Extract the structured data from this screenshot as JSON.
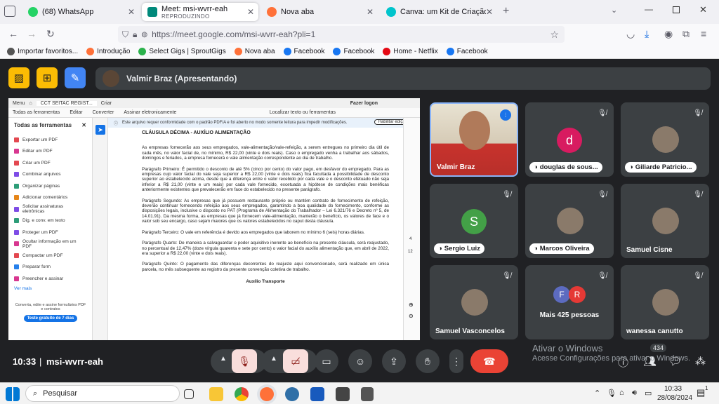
{
  "tabs": [
    {
      "title": "(68) WhatsApp",
      "color": "#25d366"
    },
    {
      "title": "Meet: msi-wvrr-eah",
      "subtitle": "REPRODUZINDO",
      "color": "#00897b"
    },
    {
      "title": "Nova aba",
      "color": "#ff7139"
    },
    {
      "title": "Canva: um Kit de Criação Visual",
      "color": "#00c4cc"
    }
  ],
  "url": "https://meet.google.com/msi-wvrr-eah?pli=1",
  "bookmarks": [
    {
      "label": "Importar favoritos...",
      "icon": "import-icon",
      "color": "#555"
    },
    {
      "label": "Introdução",
      "icon": "firefox-icon",
      "color": "#ff7139"
    },
    {
      "label": "Select Gigs | SproutGigs",
      "icon": "sproutgigs-icon",
      "color": "#2bb24c"
    },
    {
      "label": "Nova aba",
      "icon": "firefox-icon",
      "color": "#ff7139"
    },
    {
      "label": "Facebook",
      "icon": "facebook-icon",
      "color": "#1877f2"
    },
    {
      "label": "Facebook",
      "icon": "facebook-icon",
      "color": "#1877f2"
    },
    {
      "label": "Home - Netflix",
      "icon": "netflix-icon",
      "color": "#e50914"
    },
    {
      "label": "Facebook",
      "icon": "facebook-icon",
      "color": "#1877f2"
    }
  ],
  "presenter": "Valmir Braz (Apresentando)",
  "pdf": {
    "menu": "Menu",
    "tab": "CCT SEITAC REGIST...",
    "new_tab": "Criar",
    "login": "Fazer logon",
    "toolbar": [
      "Todas as ferramentas",
      "Editar",
      "Converter",
      "Assinar eletronicamente"
    ],
    "search": "Localizar texto ou ferramentas",
    "panel_title": "Todas as ferramentas",
    "tools": [
      {
        "label": "Exportar um PDF",
        "color": "#e34850"
      },
      {
        "label": "Editar um PDF",
        "color": "#d83790"
      },
      {
        "label": "Criar um PDF",
        "color": "#e34850"
      },
      {
        "label": "Combinar arquivos",
        "color": "#7e4ce6"
      },
      {
        "label": "Organizar páginas",
        "color": "#2d9d78"
      },
      {
        "label": "Adicionar comentários",
        "color": "#e68619"
      },
      {
        "label": "Solicitar assinaturas eletrônicas",
        "color": "#7e4ce6"
      },
      {
        "label": "Dig. e conv. em texto",
        "color": "#2d9d78"
      },
      {
        "label": "Proteger um PDF",
        "color": "#7e4ce6"
      },
      {
        "label": "Ocultar informação em um PDF",
        "color": "#d83790"
      },
      {
        "label": "Compactar um PDF",
        "color": "#e34850"
      },
      {
        "label": "Preparar form",
        "color": "#2680eb"
      },
      {
        "label": "Preencher e assinar",
        "color": "#d83790"
      }
    ],
    "more": "Ver mais",
    "promo": "Converta, edite e assine formulários PDF e contratos",
    "trial": "Teste gratuito de 7 dias",
    "notice": "Este arquivo requer conformidade com o padrão PDF/A e foi aberto no modo somente leitura para impedir modificações.",
    "enable": "Habilitar edição",
    "page_num": "12",
    "page_prev": "4"
  },
  "doc": {
    "heading": "CLÁUSULA DÉCIMA - AUXÍLIO ALIMENTAÇÃO",
    "p0": "As empresas fornecerão aos seus empregados, vale-alimentação/vale-refeição, a serem entregues no primeiro dia útil de cada mês, no valor facial de, no mínimo, R$ 22,00 (vinte e dois reais). Caso o empregado venha a trabalhar aos sábados, domingos e feriados, a empresa fornecerá o vale alimentação correspondente ao dia de trabalho.",
    "p1": "Parágrafo Primeiro: É permitido o desconto de até 5% (cinco por cento) do valor pago, em desfavor do empregado. Para as empresas cujo valor facial do vale seja superior a R$ 22,00 (vinte e dois reais) fica facultada a possibilidade de desconto superior ao estabelecido acima, desde que a diferença entre o valor recebido por cada vale e o desconto efetuado não seja inferior a R$ 21,00 (vinte e um reais) por cada vale fornecido, excetuada a hipótese de condições mais benéficas anteriormente existentes que prevalecerão em face do estabelecido no presente parágrafo.",
    "p2": "Parágrafo Segundo: As empresas que já possuem restaurante próprio ou mantém contrato de fornecimento de refeição, deverão continuar fornecendo refeição aos seus empregados, garantindo a boa qualidade do fornecimento, conforme as disposições legais, inclusive o disposto no PAT (Programa de Alimentação do Trabalhador – Lei 6.321/76 e Decreto nº 5, de 14.01.91). Da mesma forma, as empresas que já fornecem vale-alimentação, manterão o benefício, os valores de face e o valor sob seu encargo, caso sejam maiores que os valores estabelecidos no caput desta cláusula.",
    "p3": "Parágrafo Terceiro: O vale em referência é devido aos empregados que laborem no mínimo 6 (seis) horas diárias.",
    "p4": "Parágrafo Quarto: De maneira a salvaguardar o poder aquisitivo inerente ao benefício na presente cláusula, será reajustado, no percentual de 12,47% (doze vírgula quarenta e sete por cento) o valor facial do auxílio alimentação que, em abril de 2022, era superior a R$ 22,00 (vinte e dois reais).",
    "p5": "Parágrafo Quinto: O pagamento das diferenças decorrentes do reajuste aqui convencionado, será realizado em única parcela, no mês subsequente ao registro da presente convenção coletiva de trabalho.",
    "next": "Auxílio Transporte"
  },
  "participants": [
    {
      "name": "Valmir Braz",
      "style": "video"
    },
    {
      "name": "douglas de sous...",
      "letter": "d",
      "color": "#d81b60",
      "style": "pill"
    },
    {
      "name": "Giliarde Patricio...",
      "style": "pill-photo"
    },
    {
      "name": "Sergio Luiz",
      "letter": "S",
      "color": "#43a047",
      "style": "pill"
    },
    {
      "name": "Marcos Oliveira",
      "style": "pill-photo"
    },
    {
      "name": "Samuel Cisne",
      "style": "photo"
    },
    {
      "name": "Samuel Vasconcelos",
      "style": "photo"
    },
    {
      "name": "Mais 425 pessoas",
      "style": "more",
      "avatars": [
        {
          "letter": "F",
          "color": "#5c6bc0"
        },
        {
          "letter": "R",
          "color": "#e53935"
        }
      ]
    },
    {
      "name": "wanessa canutto",
      "style": "photo"
    }
  ],
  "meeting": {
    "time": "10:33",
    "code": "msi-wvrr-eah",
    "people_count": "434"
  },
  "watermark": {
    "title": "Ativar o Windows",
    "sub": "Acesse Configurações para ativar o Windows."
  },
  "taskbar": {
    "search": "Pesquisar",
    "time": "10:33",
    "date": "28/08/2024",
    "notif": "1"
  }
}
